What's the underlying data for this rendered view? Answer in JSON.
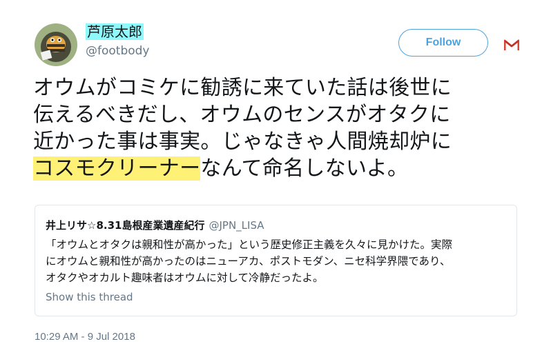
{
  "author": {
    "display_name": "芦原太郎",
    "username": "@footbody",
    "avatar_icon": "bee-character-avatar"
  },
  "follow_button": {
    "label": "Follow"
  },
  "more_icon": "gmail-m-icon",
  "tweet": {
    "lines": [
      "オウムがコミケに勧誘に来ていた話は後世に",
      "伝えるべきだし、オウムのセンスがオタクに",
      "近かった事は事実。じゃなきゃ人間焼却炉に"
    ],
    "highlight": "コスモクリーナー",
    "last_line_rest": "なんて命名しないよ。",
    "highlight_color": "#fff176"
  },
  "quote": {
    "name": "井上リサ☆8.31島根産業遺産紀行",
    "username": "@JPN_LISA",
    "body_lines": [
      "「オウムとオタクは親和性が高かった」という歴史修正主義を久々に見かけた。実際",
      "にオウムと親和性が高かったのはニューアカ、ポストモダン、ニセ科学界隈であり、",
      "オタクやオカルト趣味者はオウムに対して冷静だったよ。"
    ],
    "show_thread": "Show this thread"
  },
  "timestamp": "10:29 AM - 9 Jul 2018",
  "colors": {
    "name_highlight": "#8ff8fb",
    "follow_blue": "#4aa3df",
    "secondary_text": "#657786",
    "border": "#e1e8ed"
  }
}
